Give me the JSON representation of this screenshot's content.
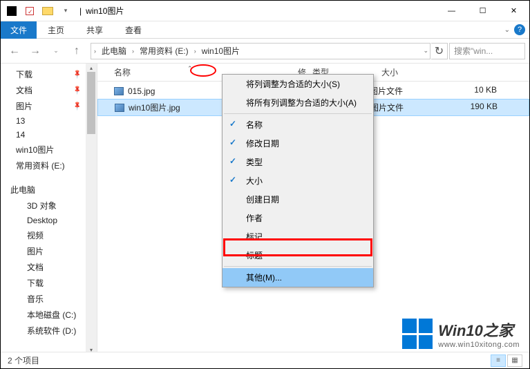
{
  "window": {
    "title": "win10图片",
    "sep": "|"
  },
  "ribbon": {
    "file": "文件",
    "tabs": [
      "主页",
      "共享",
      "查看"
    ]
  },
  "nav": {
    "back": "←",
    "forward": "→",
    "up": "↑",
    "breadcrumbs": [
      "此电脑",
      "常用资料 (E:)",
      "win10图片"
    ],
    "refresh": "↻",
    "search_placeholder": "搜索\"win..."
  },
  "tree": {
    "items": [
      {
        "label": "下载",
        "pinned": true
      },
      {
        "label": "文档",
        "pinned": true
      },
      {
        "label": "图片",
        "pinned": true
      },
      {
        "label": "13"
      },
      {
        "label": "14"
      },
      {
        "label": "win10图片"
      },
      {
        "label": "常用资料 (E:)"
      }
    ],
    "section2": "此电脑",
    "items2": [
      {
        "label": "3D 对象"
      },
      {
        "label": "Desktop"
      },
      {
        "label": "视频"
      },
      {
        "label": "图片"
      },
      {
        "label": "文档"
      },
      {
        "label": "下载"
      },
      {
        "label": "音乐"
      },
      {
        "label": "本地磁盘 (C:)"
      },
      {
        "label": "系统软件 (D:)"
      }
    ]
  },
  "columns": {
    "name": "名称",
    "date": "修改日期",
    "type": "类型",
    "size": "大小"
  },
  "files": [
    {
      "name": "015.jpg",
      "type": "图片文件",
      "size": "10 KB",
      "selected": false
    },
    {
      "name": "win10图片.jpg",
      "type": "图片文件",
      "size": "190 KB",
      "selected": true
    }
  ],
  "context_menu": {
    "items": [
      {
        "label": "将列调整为合适的大小(S)"
      },
      {
        "label": "将所有列调整为合适的大小(A)"
      },
      {
        "sep": true
      },
      {
        "label": "名称",
        "checked": true
      },
      {
        "label": "修改日期",
        "checked": true
      },
      {
        "label": "类型",
        "checked": true
      },
      {
        "label": "大小",
        "checked": true
      },
      {
        "label": "创建日期"
      },
      {
        "label": "作者"
      },
      {
        "label": "标记"
      },
      {
        "label": "标题"
      },
      {
        "sep": true
      },
      {
        "label": "其他(M)...",
        "highlight": true
      }
    ]
  },
  "status": {
    "count": "2 个项目"
  },
  "watermark": {
    "title": "Win10之家",
    "url": "www.win10xitong.com"
  }
}
